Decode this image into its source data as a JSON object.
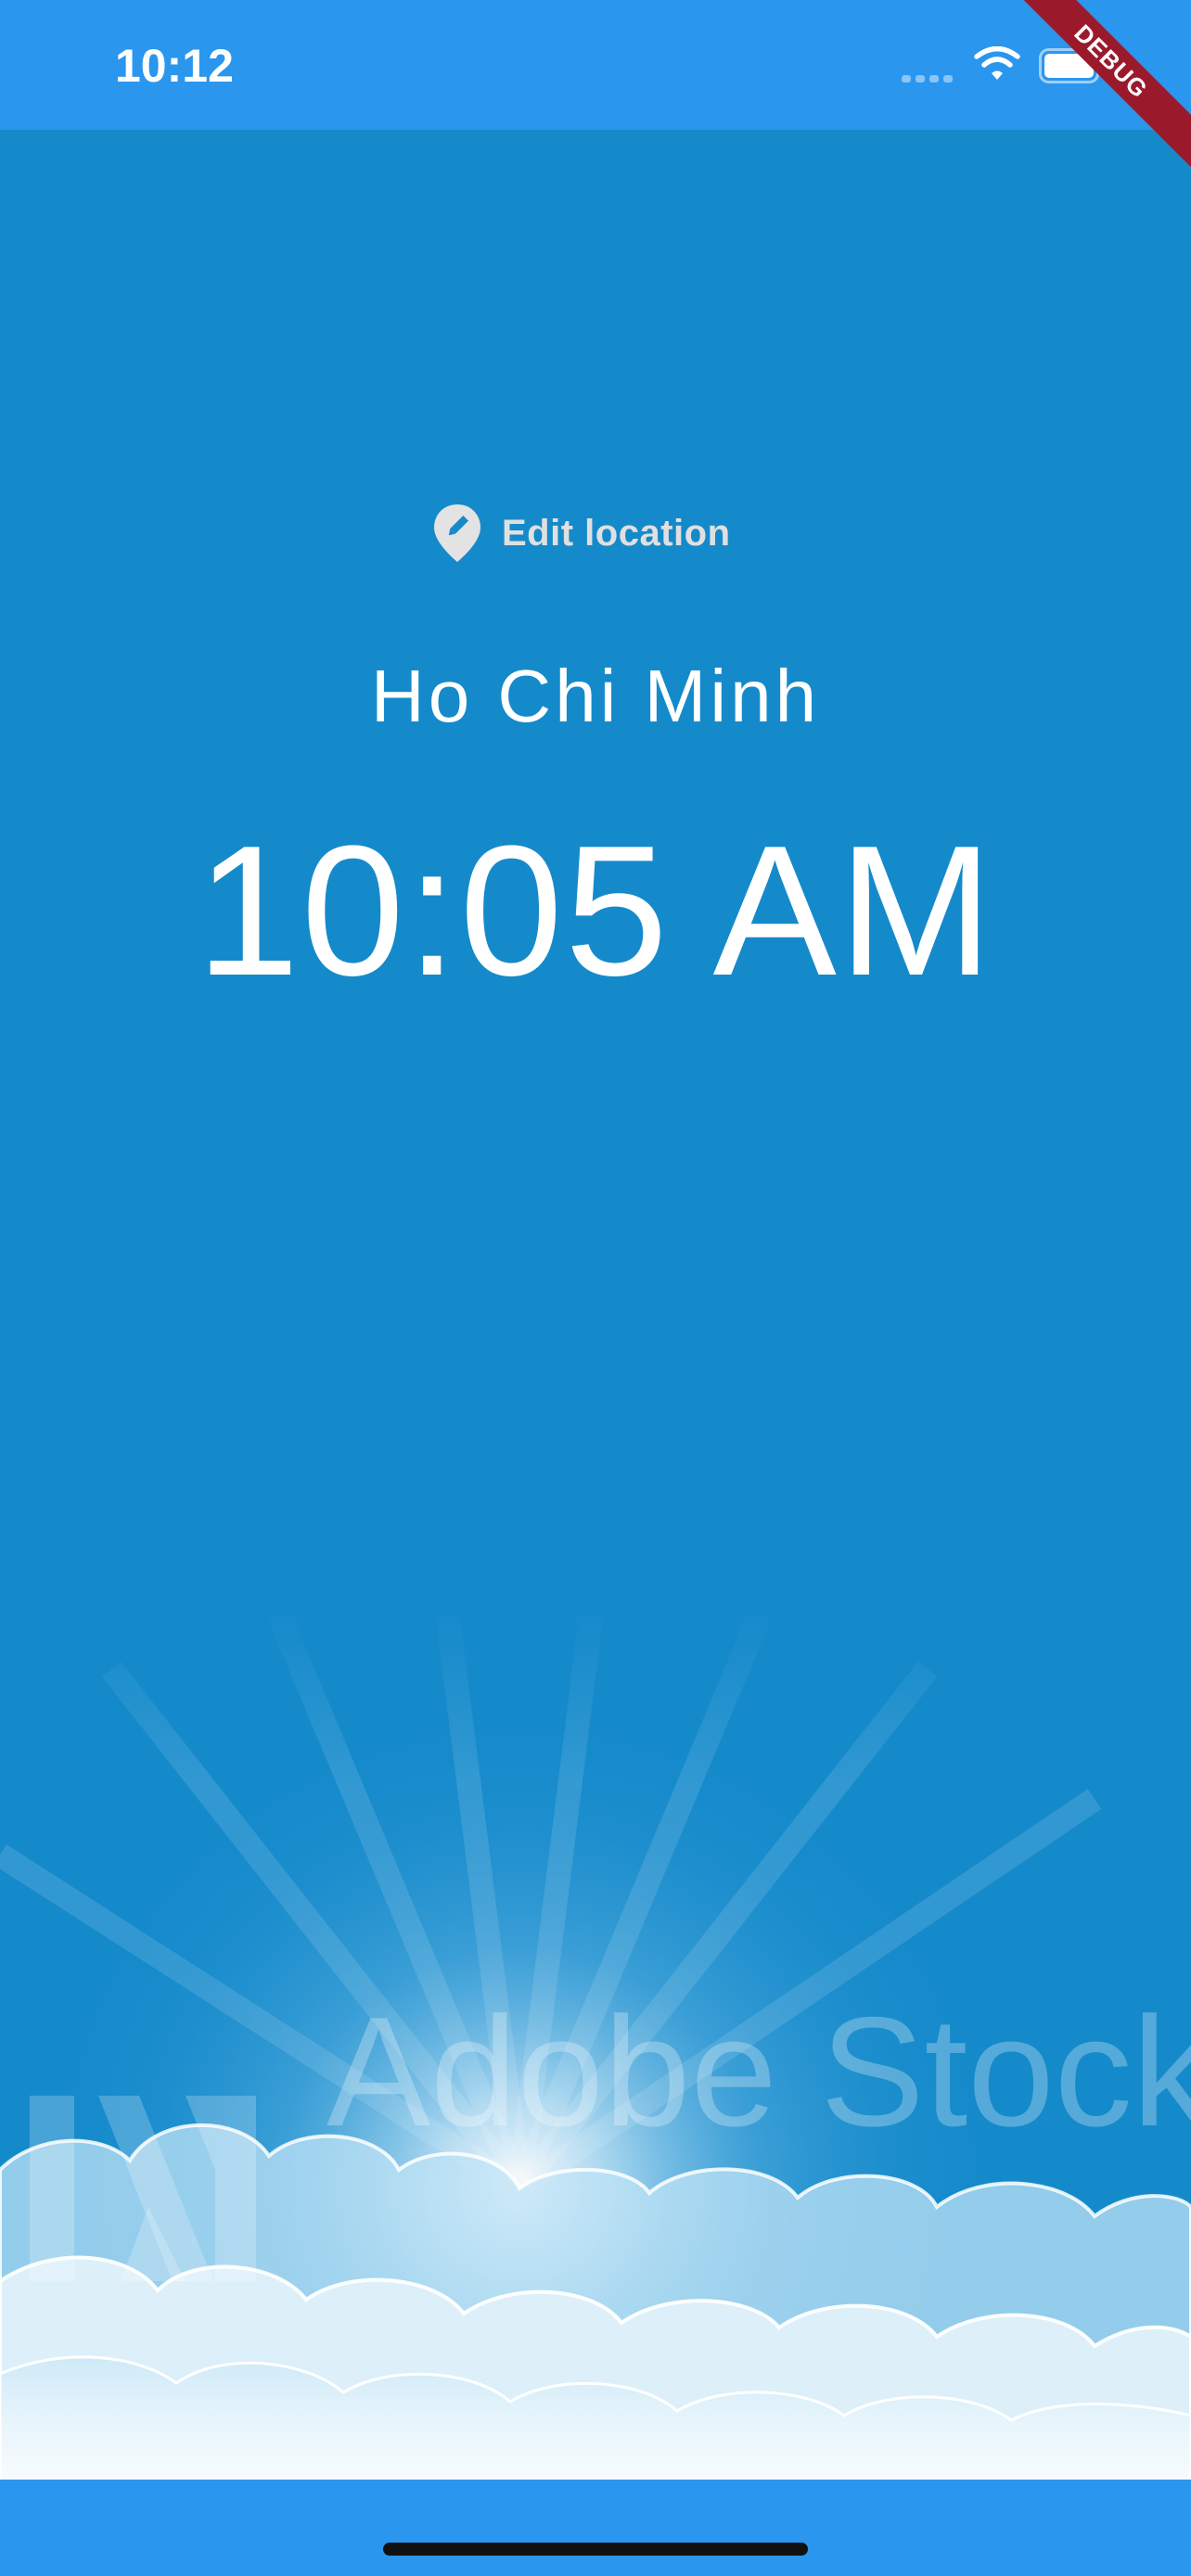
{
  "status_bar": {
    "time": "10:12",
    "wifi_icon": "wifi-icon",
    "battery_icon": "battery-icon",
    "background": "#2A96EE"
  },
  "debug_banner": {
    "label": "DEBUG",
    "color": "#9A1A2C"
  },
  "screen": {
    "background": "#158ACB",
    "edit_location": {
      "icon": "location-pin-edit-icon",
      "label": "Edit location"
    },
    "city": "Ho Chi Minh",
    "time": "10:05 AM"
  },
  "background_image": {
    "description": "sky-with-clouds-and-sun",
    "watermark": "Adobe Stock"
  },
  "bottom_bar": {
    "home_indicator": "home-indicator"
  }
}
